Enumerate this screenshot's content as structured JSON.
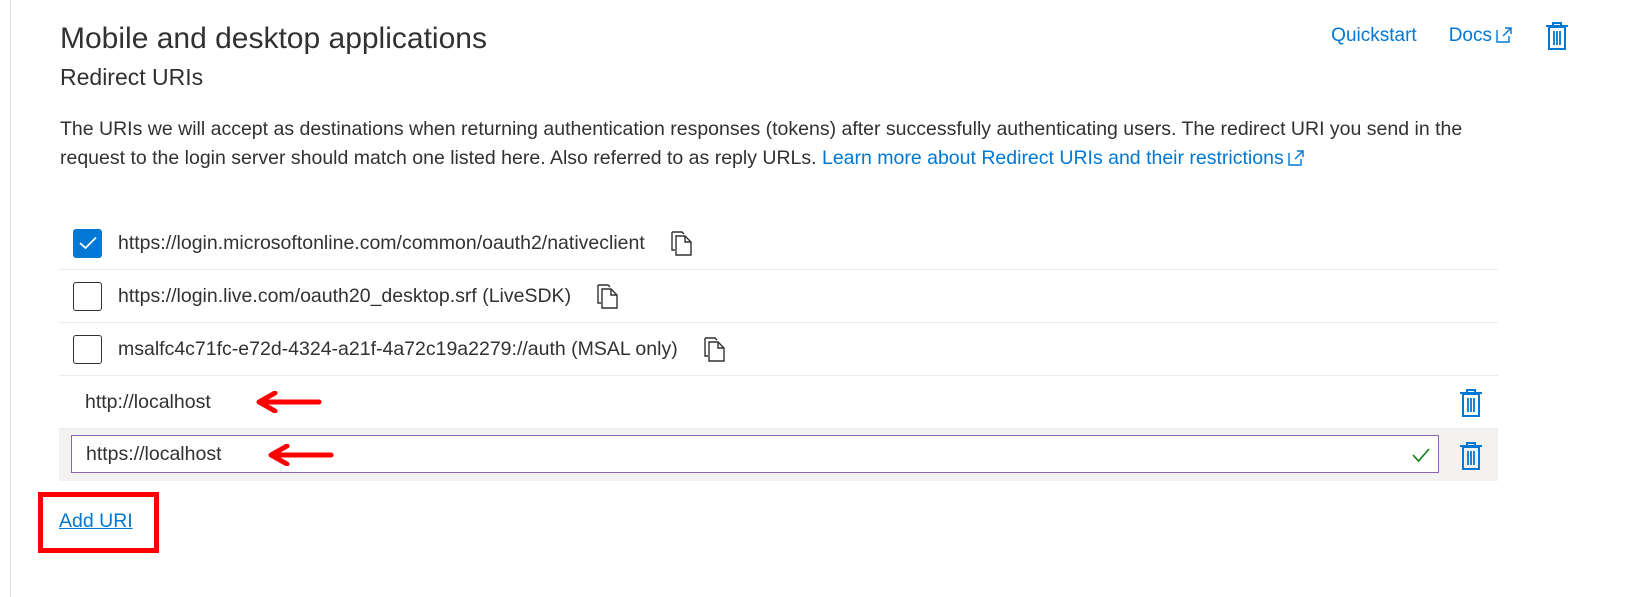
{
  "header": {
    "title": "Mobile and desktop applications",
    "subtitle": "Redirect URIs",
    "quickstart_label": "Quickstart",
    "docs_label": "Docs"
  },
  "description": {
    "text": "The URIs we will accept as destinations when returning authentication responses (tokens) after successfully authenticating users. The redirect URI you send in the request to the login server should match one listed here. Also referred to as reply URLs. ",
    "link_text": "Learn more about Redirect URIs and their restrictions"
  },
  "suggested_uris": [
    {
      "uri": "https://login.microsoftonline.com/common/oauth2/nativeclient",
      "checked": true
    },
    {
      "uri": "https://login.live.com/oauth20_desktop.srf (LiveSDK)",
      "checked": false
    },
    {
      "uri": "msalfc4c71fc-e72d-4324-a21f-4a72c19a2279://auth (MSAL only)",
      "checked": false
    }
  ],
  "custom_uris": [
    {
      "uri": "http://localhost"
    },
    {
      "uri": "https://localhost"
    }
  ],
  "add_uri_label": "Add URI",
  "colors": {
    "accent": "#0078d4",
    "annotation": "#ff0000",
    "input_focus_border": "#8764b8",
    "valid_check": "#107c10"
  },
  "icons": {
    "docs": "external-link-icon",
    "delete": "trash-icon",
    "copy": "copy-icon",
    "checkbox": "checkmark-icon",
    "validation": "valid-checkmark-icon",
    "annotation": "red-arrow-icon"
  }
}
